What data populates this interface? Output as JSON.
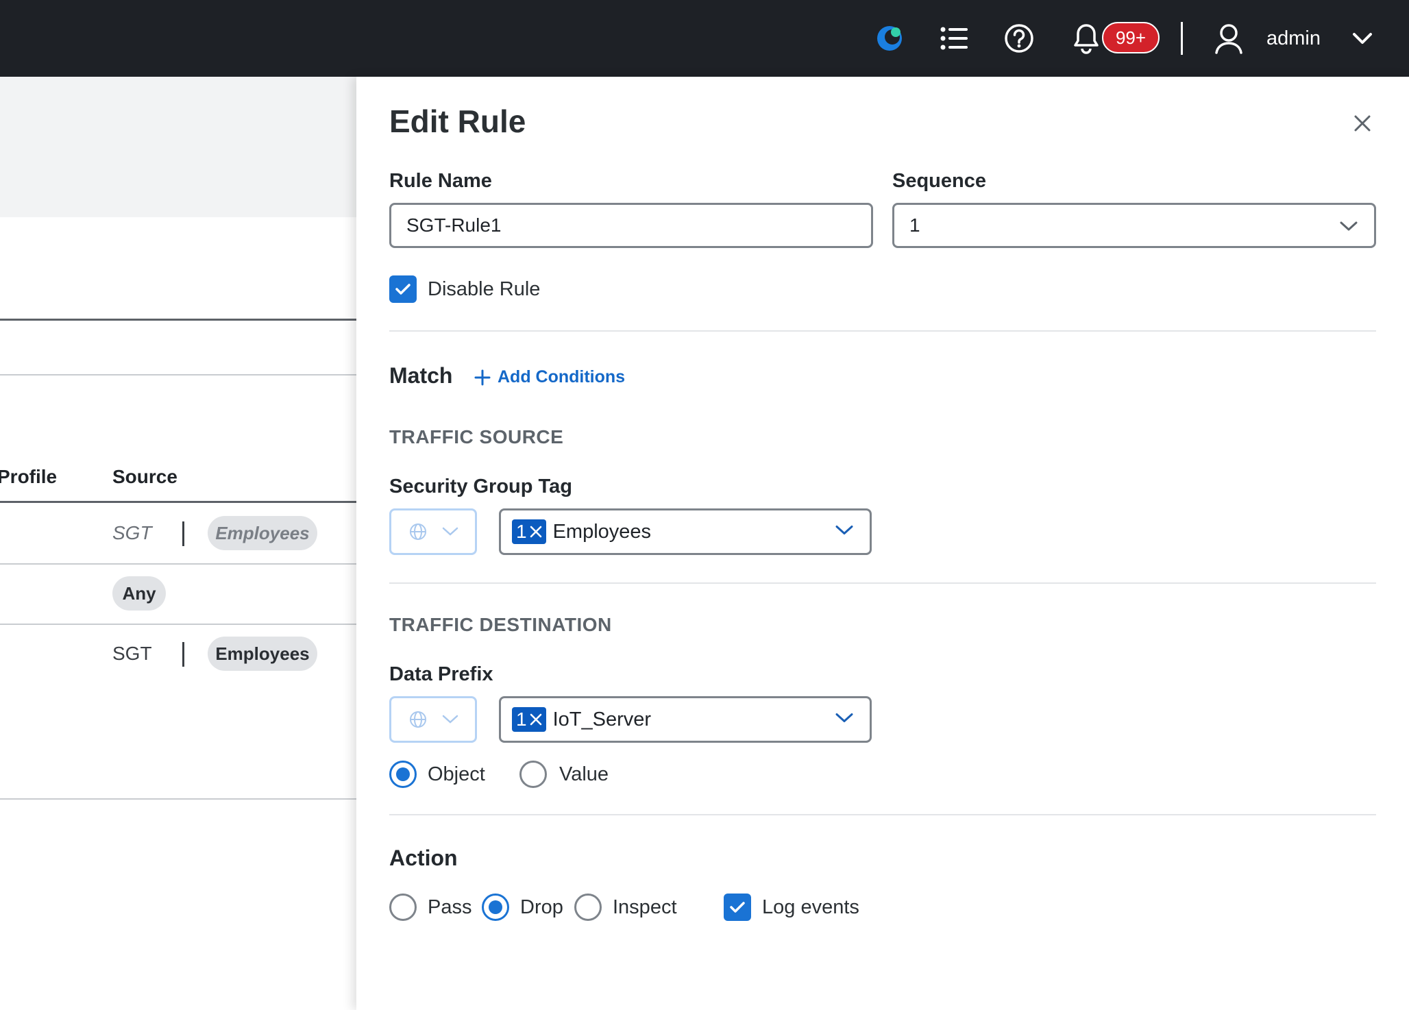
{
  "header": {
    "badge_count": "99+",
    "username": "admin",
    "icons": [
      "app-logo-icon",
      "task-list-icon",
      "help-icon",
      "bell-icon",
      "user-icon",
      "chevron-down-icon"
    ]
  },
  "table": {
    "columns": [
      "Profile",
      "Source"
    ],
    "rows": [
      {
        "source_type": "SGT",
        "source_value": "Employees",
        "style": "disabled"
      },
      {
        "source_type": "",
        "source_value": "Any",
        "style": "normal"
      },
      {
        "source_type": "SGT",
        "source_value": "Employees",
        "style": "normal"
      }
    ]
  },
  "drawer": {
    "title": "Edit Rule",
    "rule_name_label": "Rule Name",
    "rule_name_value": "SGT-Rule1",
    "sequence_label": "Sequence",
    "sequence_value": "1",
    "disable_rule_label": "Disable Rule",
    "disable_rule_checked": true,
    "match_title": "Match",
    "add_conditions_label": "Add Conditions",
    "traffic_source": {
      "heading": "TRAFFIC SOURCE",
      "field_label": "Security Group Tag",
      "chip_count": "1",
      "selected": "Employees"
    },
    "traffic_destination": {
      "heading": "TRAFFIC DESTINATION",
      "field_label": "Data Prefix",
      "chip_count": "1",
      "selected": "IoT_Server",
      "options": [
        "Object",
        "Value"
      ],
      "selected_option": "Object"
    },
    "action": {
      "title": "Action",
      "options": [
        "Pass",
        "Drop",
        "Inspect"
      ],
      "selected": "Drop",
      "log_events_label": "Log events",
      "log_events_checked": true
    }
  },
  "colors": {
    "topbar": "#1e2126",
    "accent": "#1a73d4",
    "badge": "#d3222a",
    "chip": "#0b5bbf"
  }
}
